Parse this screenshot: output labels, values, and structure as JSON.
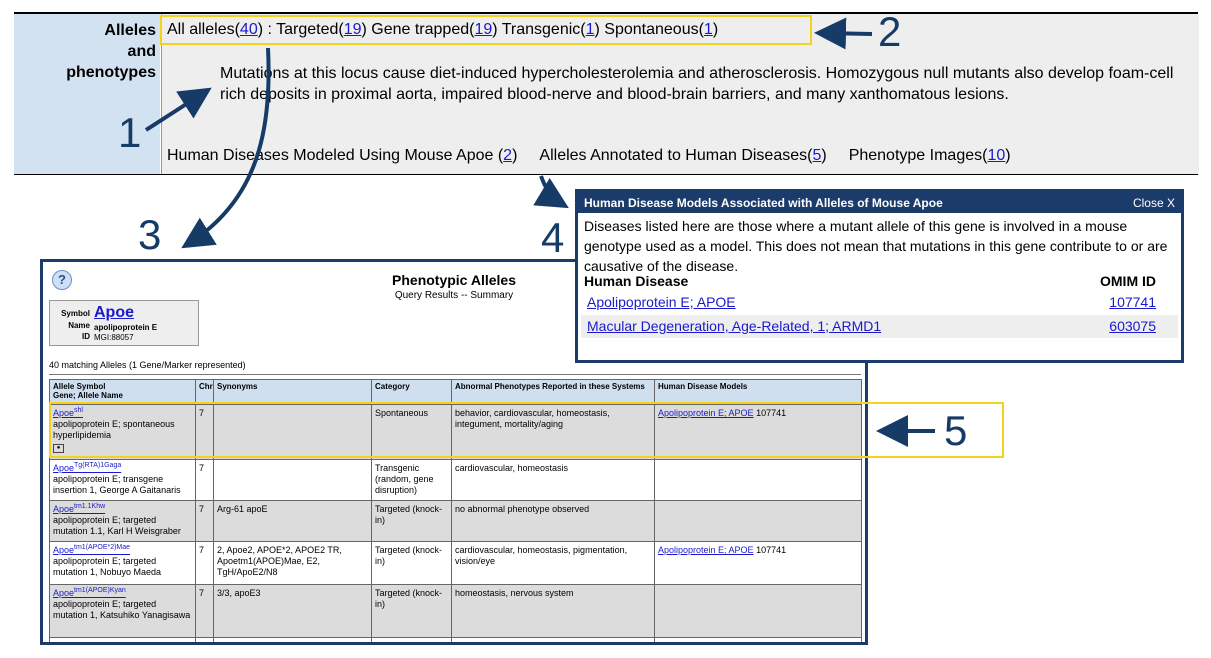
{
  "strip": {
    "label_lines": [
      "Alleles",
      "and",
      "phenotypes"
    ],
    "all_alleles_label": "All alleles(",
    "all_alleles_count": "40",
    "targeted_label": ") : Targeted(",
    "targeted_count": "19",
    "gene_trapped_label": ") Gene trapped(",
    "gene_trapped_count": "19",
    "transgenic_label": ") Transgenic(",
    "transgenic_count": "1",
    "spontaneous_label": ") Spontaneous(",
    "spontaneous_count": "1",
    "close_paren": ")",
    "description": "Mutations at this locus cause diet-induced hypercholesterolemia and atherosclerosis. Homozygous null mutants also develop foam-cell rich deposits in proximal aorta, impaired blood-nerve and blood-brain barriers, and many xanthomatous lesions.",
    "human_diseases_label": "Human Diseases Modeled Using Mouse Apoe (",
    "human_diseases_count": "2",
    "alleles_annotated_label": "Alleles Annotated to Human Diseases(",
    "alleles_annotated_count": "5",
    "phenotype_images_label": "Phenotype Images(",
    "phenotype_images_count": "10"
  },
  "callouts": [
    "1",
    "2",
    "3",
    "4",
    "5"
  ],
  "pheno": {
    "help_symbol": "?",
    "title": "Phenotypic Alleles",
    "subtitle": "Query Results -- Summary",
    "symbol_key": "Symbol",
    "name_key": "Name",
    "id_key": "ID",
    "symbol": "Apoe",
    "name": "apolipoprotein E",
    "mgi_id": "MGI:88057",
    "count_text": "40 matching Alleles (1 Gene/Marker represented)",
    "headers": [
      "Allele Symbol\nGene; Allele Name",
      "Chr",
      "Synonyms",
      "Category",
      "Abnormal Phenotypes Reported in these Systems",
      "Human Disease Models"
    ],
    "rows": [
      {
        "symbol": "Apoe",
        "sup": "shl",
        "name": "apolipoprotein E; spontaneous hyperlipidemia",
        "chr": "7",
        "synonyms": "",
        "category": "Spontaneous",
        "phenotypes": "behavior, cardiovascular, homeostasis, integument, mortality/aging",
        "disease_link": "Apolipoprotein E; APOE",
        "disease_id": "107741"
      },
      {
        "symbol": "Apoe",
        "sup": "Tg(RTA)1Gaga",
        "name": "apolipoprotein E; transgene insertion 1, George A Gaitanaris",
        "chr": "7",
        "synonyms": "",
        "category": "Transgenic (random, gene disruption)",
        "phenotypes": "cardiovascular, homeostasis",
        "disease_link": "",
        "disease_id": ""
      },
      {
        "symbol": "Apoe",
        "sup": "tm1.1Khw",
        "name": "apolipoprotein E; targeted mutation 1.1, Karl H Weisgraber",
        "chr": "7",
        "synonyms": "Arg-61 apoE",
        "category": "Targeted (knock-in)",
        "phenotypes": "no abnormal phenotype observed",
        "disease_link": "",
        "disease_id": ""
      },
      {
        "symbol": "Apoe",
        "sup": "tm1(APOE*2)Mae",
        "name": "apolipoprotein E; targeted mutation 1, Nobuyo Maeda",
        "chr": "7",
        "synonyms": "2, Apoe2, APOE*2, APOE2 TR, Apoetm1(APOE)Mae, E2, TgH/ApoE2/N8",
        "category": "Targeted (knock-in)",
        "phenotypes": "cardiovascular, homeostasis, pigmentation, vision/eye",
        "disease_link": "Apolipoprotein E; APOE",
        "disease_id": "107741"
      },
      {
        "symbol": "Apoe",
        "sup": "tm1(APOE)Kyan",
        "name": "apolipoprotein E; targeted mutation 1, Katsuhiko Yanagisawa",
        "chr": "7",
        "synonyms": "3/3, apoE3",
        "category": "Targeted (knock-in)",
        "phenotypes": "homeostasis, nervous system",
        "disease_link": "",
        "disease_id": ""
      }
    ]
  },
  "hdm": {
    "title": "Human Disease Models Associated with Alleles of Mouse Apoe",
    "close": "Close X",
    "note": "Diseases listed here are those where a mutant allele of this gene is involved in a mouse genotype used as a model. This does not mean that mutations in this gene contribute to or are causative of the disease.",
    "col_disease": "Human Disease",
    "col_omim": "OMIM ID",
    "rows": [
      {
        "disease": "Apolipoprotein E; APOE",
        "omim": "107741"
      },
      {
        "disease": "Macular Degeneration, Age-Related, 1; ARMD1",
        "omim": "603075"
      }
    ]
  },
  "colors": {
    "navy": "#1b3b6a",
    "highlight": "#f2d21b",
    "label_bg": "#d3e2f0",
    "link": "#1a1acc"
  }
}
